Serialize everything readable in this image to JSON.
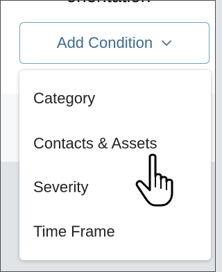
{
  "add_condition_button": {
    "label": "Add Condition"
  },
  "caption": "orientation",
  "menu": {
    "items": [
      {
        "label": "Category"
      },
      {
        "label": "Contacts & Assets"
      },
      {
        "label": "Severity"
      },
      {
        "label": "Time Frame"
      }
    ]
  },
  "icons": {
    "dropdown": "chevron-down-icon",
    "cursor": "hand-pointer-icon"
  },
  "colors": {
    "accent": "#3d6b8f",
    "button_border": "#6fa3c9",
    "menu_text": "#222222",
    "background": "#e1e4e7"
  }
}
